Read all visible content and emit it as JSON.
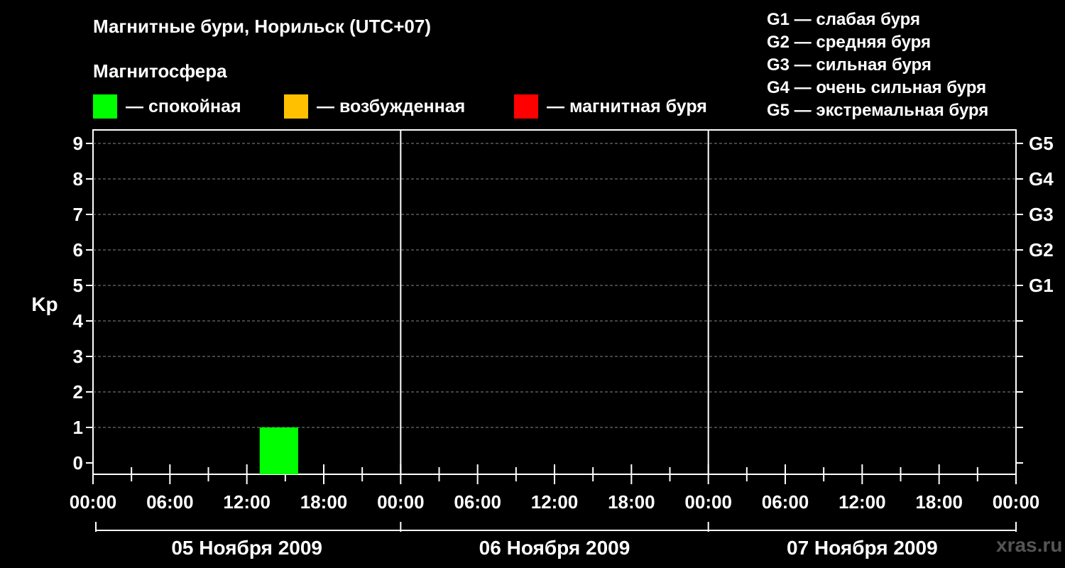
{
  "title": "Магнитные бури, Норильск (UTC+07)",
  "subtitle": "Магнитосфера",
  "legend": [
    {
      "label": "— спокойная",
      "color": "#00ff00"
    },
    {
      "label": "— возбужденная",
      "color": "#ffc000"
    },
    {
      "label": "— магнитная буря",
      "color": "#ff0000"
    }
  ],
  "g_scale": [
    "G1 — слабая буря",
    "G2 — средняя буря",
    "G3 — сильная буря",
    "G4 — очень сильная буря",
    "G5 — экстремальная буря"
  ],
  "watermark": "xras.ru",
  "chart_data": {
    "type": "bar",
    "ylabel": "Kp",
    "ylim": [
      0,
      9
    ],
    "y_ticks": [
      "0",
      "1",
      "2",
      "3",
      "4",
      "5",
      "6",
      "7",
      "8",
      "9"
    ],
    "right_axis_labels": [
      {
        "kp": 5,
        "label": "G1"
      },
      {
        "kp": 6,
        "label": "G2"
      },
      {
        "kp": 7,
        "label": "G3"
      },
      {
        "kp": 8,
        "label": "G4"
      },
      {
        "kp": 9,
        "label": "G5"
      }
    ],
    "x_tick_labels": [
      "00:00",
      "06:00",
      "12:00",
      "18:00",
      "00:00",
      "06:00",
      "12:00",
      "18:00",
      "00:00",
      "06:00",
      "12:00",
      "18:00",
      "00:00"
    ],
    "days": [
      "05 Ноября 2009",
      "06 Ноября 2009",
      "07 Ноября 2009"
    ],
    "interval_hours": 3,
    "bars": [
      {
        "day": "05 Ноября 2009",
        "start": "13:00",
        "end": "16:00",
        "kp": 1,
        "status": "спокойная",
        "color": "#00ff00"
      }
    ],
    "grid": true
  }
}
